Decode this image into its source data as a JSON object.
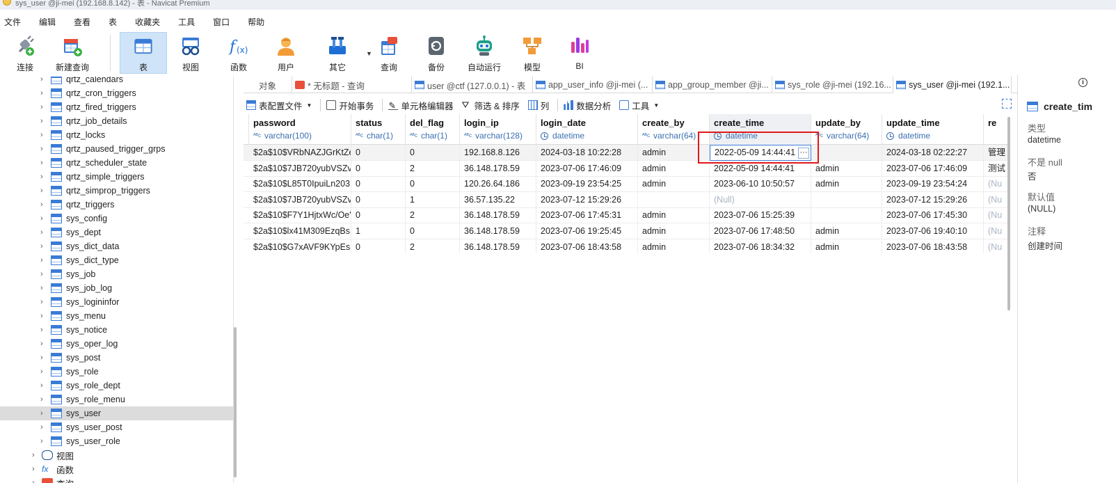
{
  "window": {
    "title": "sys_user @ji-mei (192.168.8.142) - 表 - Navicat Premium"
  },
  "menu": [
    "文件",
    "编辑",
    "查看",
    "表",
    "收藏夹",
    "工具",
    "窗口",
    "帮助"
  ],
  "toolbar": {
    "connect": "连接",
    "new_query": "新建查询",
    "table": "表",
    "view": "视图",
    "function": "函数",
    "user": "用户",
    "other": "其它",
    "query": "查询",
    "backup": "备份",
    "automation": "自动运行",
    "model": "模型",
    "bi": "BI"
  },
  "sidebar": {
    "tables": [
      "qrtz_calendars",
      "qrtz_cron_triggers",
      "qrtz_fired_triggers",
      "qrtz_job_details",
      "qrtz_locks",
      "qrtz_paused_trigger_grps",
      "qrtz_scheduler_state",
      "qrtz_simple_triggers",
      "qrtz_simprop_triggers",
      "qrtz_triggers",
      "sys_config",
      "sys_dept",
      "sys_dict_data",
      "sys_dict_type",
      "sys_job",
      "sys_job_log",
      "sys_logininfor",
      "sys_menu",
      "sys_notice",
      "sys_oper_log",
      "sys_post",
      "sys_role",
      "sys_role_dept",
      "sys_role_menu",
      "sys_user",
      "sys_user_post",
      "sys_user_role"
    ],
    "selected": "sys_user",
    "groups": {
      "views": "视图",
      "functions": "函数",
      "queries": "查询"
    }
  },
  "tabs": [
    {
      "label": "对象"
    },
    {
      "label": "* 无标题 - 查询"
    },
    {
      "label": "user @ctf (127.0.0.1) - 表"
    },
    {
      "label": "app_user_info @ji-mei (..."
    },
    {
      "label": "app_group_member @ji..."
    },
    {
      "label": "sys_role @ji-mei (192.16..."
    },
    {
      "label": "sys_user @ji-mei (192.1..."
    }
  ],
  "gridbar": {
    "config_file": "表配置文件",
    "begin_transaction": "开始事务",
    "cell_editor": "单元格编辑器",
    "filter_sort": "筛选 & 排序",
    "columns": "列",
    "data_analysis": "数据分析",
    "tools": "工具"
  },
  "grid": {
    "columns": [
      {
        "name": "password",
        "type": "varchar(100)",
        "kind": "text"
      },
      {
        "name": "status",
        "type": "char(1)",
        "kind": "text"
      },
      {
        "name": "del_flag",
        "type": "char(1)",
        "kind": "text"
      },
      {
        "name": "login_ip",
        "type": "varchar(128)",
        "kind": "text"
      },
      {
        "name": "login_date",
        "type": "datetime",
        "kind": "datetime"
      },
      {
        "name": "create_by",
        "type": "varchar(64)",
        "kind": "text"
      },
      {
        "name": "create_time",
        "type": "datetime",
        "kind": "datetime"
      },
      {
        "name": "update_by",
        "type": "varchar(64)",
        "kind": "text"
      },
      {
        "name": "update_time",
        "type": "datetime",
        "kind": "datetime"
      },
      {
        "name": "re",
        "type": "",
        "kind": "text"
      }
    ],
    "rows": [
      [
        "$2a$10$VRbNAZJGrKtZe",
        "0",
        "0",
        "192.168.8.126",
        "2024-03-18 10:22:28",
        "admin",
        "2022-05-09 14:44:41",
        "",
        "2024-03-18 02:22:27",
        "管理"
      ],
      [
        "$2a$10$7JB720yubVSZv",
        "0",
        "2",
        "36.148.178.59",
        "2023-07-06 17:46:09",
        "admin",
        "2022-05-09 14:44:41",
        "admin",
        "2023-07-06 17:46:09",
        "测试"
      ],
      [
        "$2a$10$L85T0IpuiLn203",
        "0",
        "0",
        "120.26.64.186",
        "2023-09-19 23:54:25",
        "admin",
        "2023-06-10 10:50:57",
        "admin",
        "2023-09-19 23:54:24",
        "(Nu"
      ],
      [
        "$2a$10$7JB720yubVSZv",
        "0",
        "1",
        "36.57.135.22",
        "2023-07-12 15:29:26",
        "",
        "(Null)",
        "",
        "2023-07-12 15:29:26",
        "(Nu"
      ],
      [
        "$2a$10$F7Y1HjtxWc/Oe'",
        "0",
        "2",
        "36.148.178.59",
        "2023-07-06 17:45:31",
        "admin",
        "2023-07-06 15:25:39",
        "",
        "2023-07-06 17:45:30",
        "(Nu"
      ],
      [
        "$2a$10$lx41M309EzqBs",
        "1",
        "0",
        "36.148.178.59",
        "2023-07-06 19:25:45",
        "admin",
        "2023-07-06 17:48:50",
        "admin",
        "2023-07-06 19:40:10",
        "(Nu"
      ],
      [
        "$2a$10$G7xAVF9KYpEsr",
        "0",
        "2",
        "36.148.178.59",
        "2023-07-06 18:43:58",
        "admin",
        "2023-07-06 18:34:32",
        "admin",
        "2023-07-06 18:43:58",
        "(Nu"
      ]
    ],
    "editing_cell_button": "···"
  },
  "properties": {
    "title": "create_tim",
    "info_icon": "i",
    "fields": [
      {
        "label": "类型",
        "value": "datetime"
      },
      {
        "label": "不是 null",
        "value": "否"
      },
      {
        "label": "默认值",
        "value": "(NULL)"
      },
      {
        "label": "注释",
        "value": "创建时间"
      }
    ]
  },
  "colors": {
    "accent": "#3a7bd5",
    "highlight": "#e01818",
    "selected_toolbar": "#cfe4f8"
  }
}
